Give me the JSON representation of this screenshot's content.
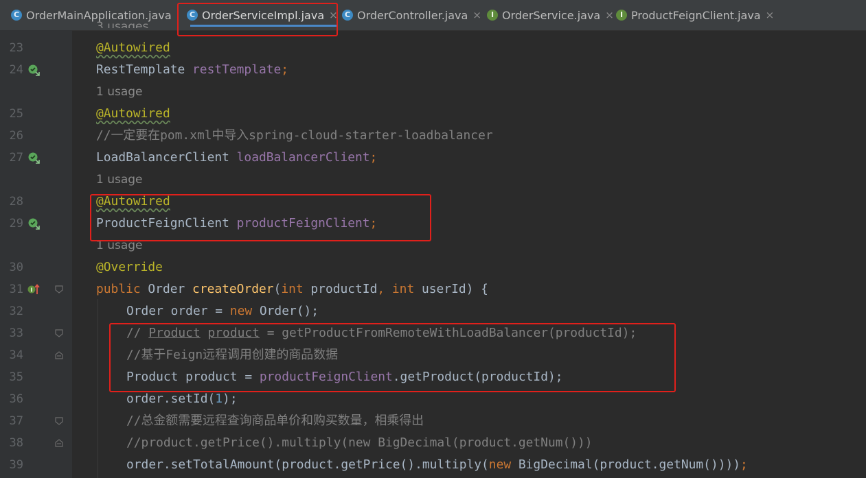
{
  "tabs": [
    {
      "label": "OrderMainApplication.java",
      "icon": "spring-app-class-icon",
      "active": false
    },
    {
      "label": "OrderServiceImpl.java",
      "icon": "class-icon",
      "active": true
    },
    {
      "label": "OrderController.java",
      "icon": "class-icon",
      "active": false
    },
    {
      "label": "OrderService.java",
      "icon": "interface-icon",
      "active": false
    },
    {
      "label": "ProductFeignClient.java",
      "icon": "interface-icon",
      "active": false
    }
  ],
  "close_glyph": "×",
  "icon_letters": {
    "class": "C",
    "interface": "I"
  },
  "hints": {
    "top": "3 usages",
    "r1": "1 usage",
    "r2": "1 usage",
    "r3": "1 usage"
  },
  "lines": {
    "l23": "23",
    "l24": "24",
    "l25": "25",
    "l26": "26",
    "l27": "27",
    "l28": "28",
    "l29": "29",
    "l30": "30",
    "l31": "31",
    "l32": "32",
    "l33": "33",
    "l34": "34",
    "l35": "35",
    "l36": "36",
    "l37": "37",
    "l38": "38",
    "l39": "39"
  },
  "code": {
    "autowired": "@Autowired",
    "override": "@Override",
    "resttemplate_type": "RestTemplate ",
    "resttemplate_field": "restTemplate",
    "semicolon": ";",
    "comment_26": "//一定要在pom.xml中导入spring-cloud-starter-loadbalancer",
    "lbc_type": "LoadBalancerClient ",
    "lbc_field": "loadBalancerClient",
    "pfc_type": "ProductFeignClient ",
    "pfc_field": "productFeignClient",
    "kw_public": "public ",
    "order_type": "Order ",
    "create_order": "createOrder",
    "paren_open": "(",
    "kw_int": "int ",
    "param_product": "productId",
    "comma": ", ",
    "param_user": "userId",
    "brace_open": ") {",
    "l32_a": "Order order = ",
    "kw_new": "new ",
    "l32_b": "Order();",
    "l33_prefix": "// ",
    "l33_u1": "Product",
    "l33_space": " ",
    "l33_u2": "product",
    "l33_rest": " = getProductFromRemoteWithLoadBalancer(productId);",
    "comment_34": "//基于Feign远程调用创建的商品数据",
    "l35_a": "Product product = ",
    "l35_b": ".getProduct(productId);",
    "l36_a": "order.setId(",
    "l36_num": "1",
    "l36_b": ");",
    "comment_37": "//总金额需要远程查询商品单价和购买数量，相乘得出",
    "comment_38": "//product.getPrice().multiply(new BigDecimal(product.getNum()))",
    "l39_a": "order.setTotalAmount(product.getPrice().multiply(",
    "l39_b": "BigDecimal(product.getNum()))",
    "l39_c": ")"
  },
  "colors": {
    "background": "#2b2b2b",
    "annotation": "#bbb529",
    "keyword": "#cc7832",
    "field": "#9876aa",
    "method": "#ffc66d",
    "number": "#6897bb",
    "comment": "#808080",
    "highlight_box": "#e0201b"
  }
}
